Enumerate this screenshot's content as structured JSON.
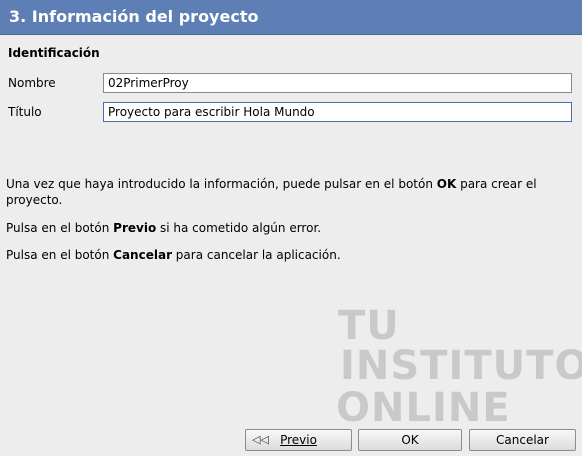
{
  "header": {
    "title": "3. Información del proyecto"
  },
  "section": {
    "title": "Identificación"
  },
  "fields": {
    "name": {
      "label": "Nombre",
      "value": "02PrimerProy"
    },
    "title": {
      "label": "Título",
      "value": "Proyecto para escribir Hola Mundo"
    }
  },
  "instructions": {
    "p1_before": "Una vez que haya introducido la información, puede pulsar en el botón ",
    "p1_bold": "OK",
    "p1_after": " para crear el proyecto.",
    "p2_before": "Pulsa en el botón ",
    "p2_bold": "Previo",
    "p2_after": " si ha cometido algún error.",
    "p3_before": "Pulsa en el botón ",
    "p3_bold": "Cancelar",
    "p3_after": " para cancelar la aplicación."
  },
  "watermark": {
    "line1": "TU",
    "line2": "INSTITUTO",
    "line3": "ONLINE"
  },
  "buttons": {
    "previous": "Previo",
    "ok": "OK",
    "cancel": "Cancelar"
  },
  "icons": {
    "previous_arrow": "rewind-arrow-icon"
  },
  "colors": {
    "header_bg": "#5d7fb5",
    "window_bg": "#ededed",
    "watermark": "#c9c9c9"
  }
}
